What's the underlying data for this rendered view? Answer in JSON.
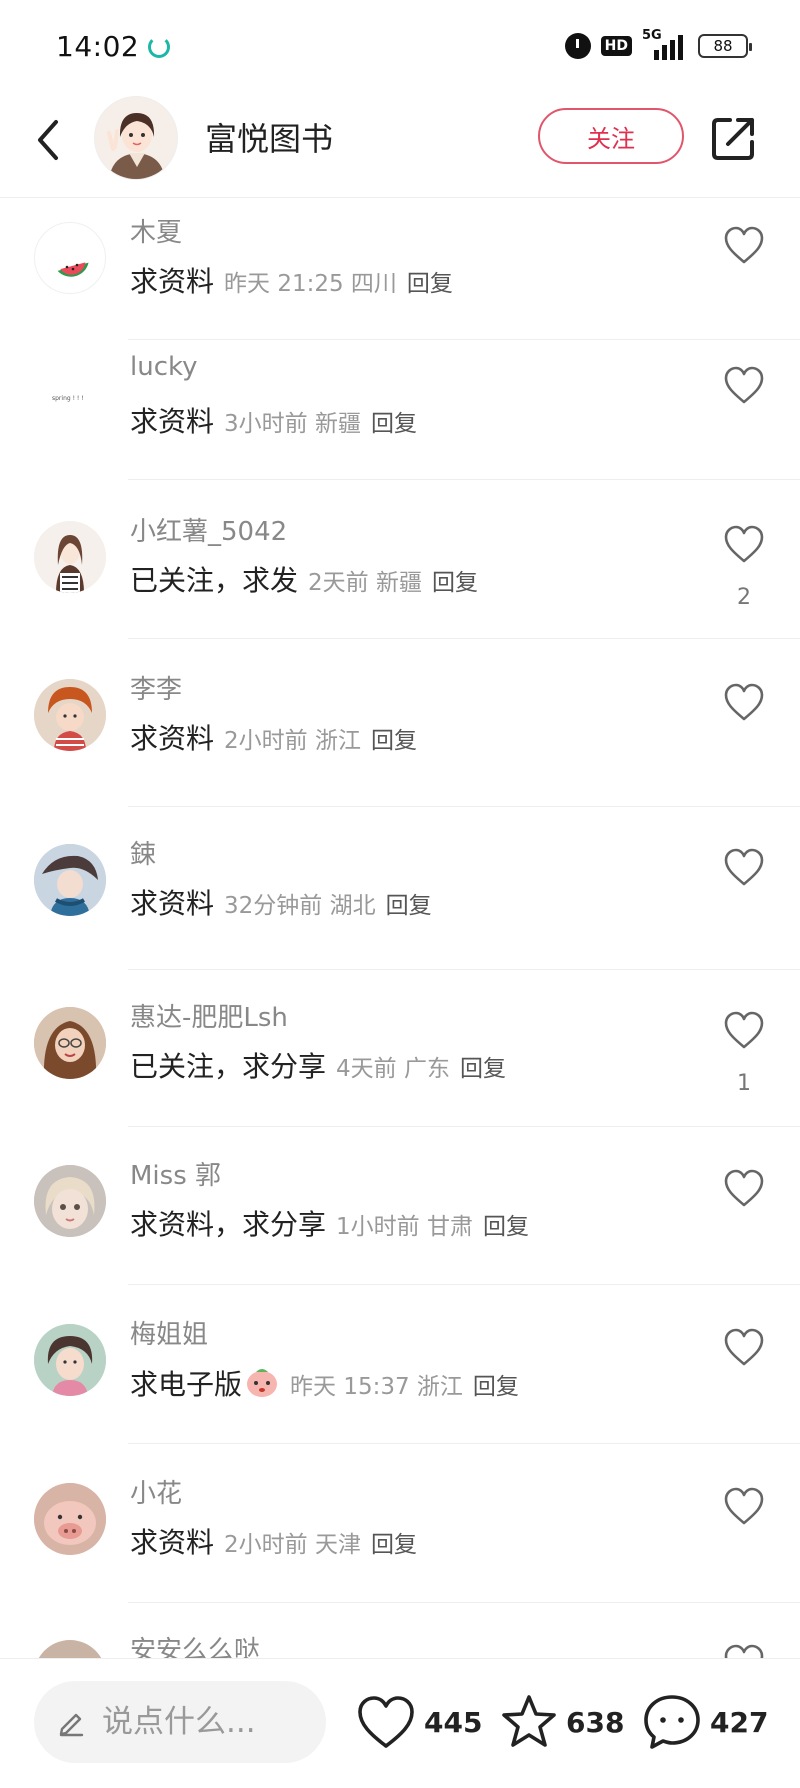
{
  "status_bar": {
    "time": "14:02",
    "hd_label": "HD",
    "network_label": "5G",
    "battery": "88"
  },
  "header": {
    "title": "富悦图书",
    "follow_label": "关注"
  },
  "comments": [
    {
      "username": "木夏",
      "text": "求资料",
      "meta": "昨天 21:25 四川",
      "reply": "回复",
      "likes": ""
    },
    {
      "username": "lucky",
      "text": "求资料",
      "meta": "3小时前 新疆",
      "reply": "回复",
      "likes": ""
    },
    {
      "username": "小红薯_5042",
      "text": "已关注，求发",
      "meta": "2天前 新疆",
      "reply": "回复",
      "likes": "2"
    },
    {
      "username": "李李",
      "text": "求资料",
      "meta": "2小时前 浙江",
      "reply": "回复",
      "likes": ""
    },
    {
      "username": "鋉",
      "text": "求资料",
      "meta": "32分钟前 湖北",
      "reply": "回复",
      "likes": ""
    },
    {
      "username": "惠达-肥肥Lsh",
      "text": "已关注，求分享",
      "meta": "4天前 广东",
      "reply": "回复",
      "likes": "1"
    },
    {
      "username": "Miss 郭",
      "text": "求资料，求分享",
      "meta": "1小时前 甘肃",
      "reply": "回复",
      "likes": ""
    },
    {
      "username": "梅姐姐",
      "text": "求电子版",
      "meta": "昨天 15:37 浙江",
      "reply": "回复",
      "likes": ""
    },
    {
      "username": "小花",
      "text": "求资料",
      "meta": "2小时前 天津",
      "reply": "回复",
      "likes": ""
    },
    {
      "username": "安安么么哒",
      "text": "",
      "meta": "",
      "reply": "",
      "likes": ""
    }
  ],
  "bottom_bar": {
    "input_placeholder": "说点什么...",
    "likes": "445",
    "favorites": "638",
    "comments": "427"
  },
  "colors": {
    "accent": "#e0304f",
    "muted_text": "#999999",
    "divider": "#eeeeee"
  }
}
